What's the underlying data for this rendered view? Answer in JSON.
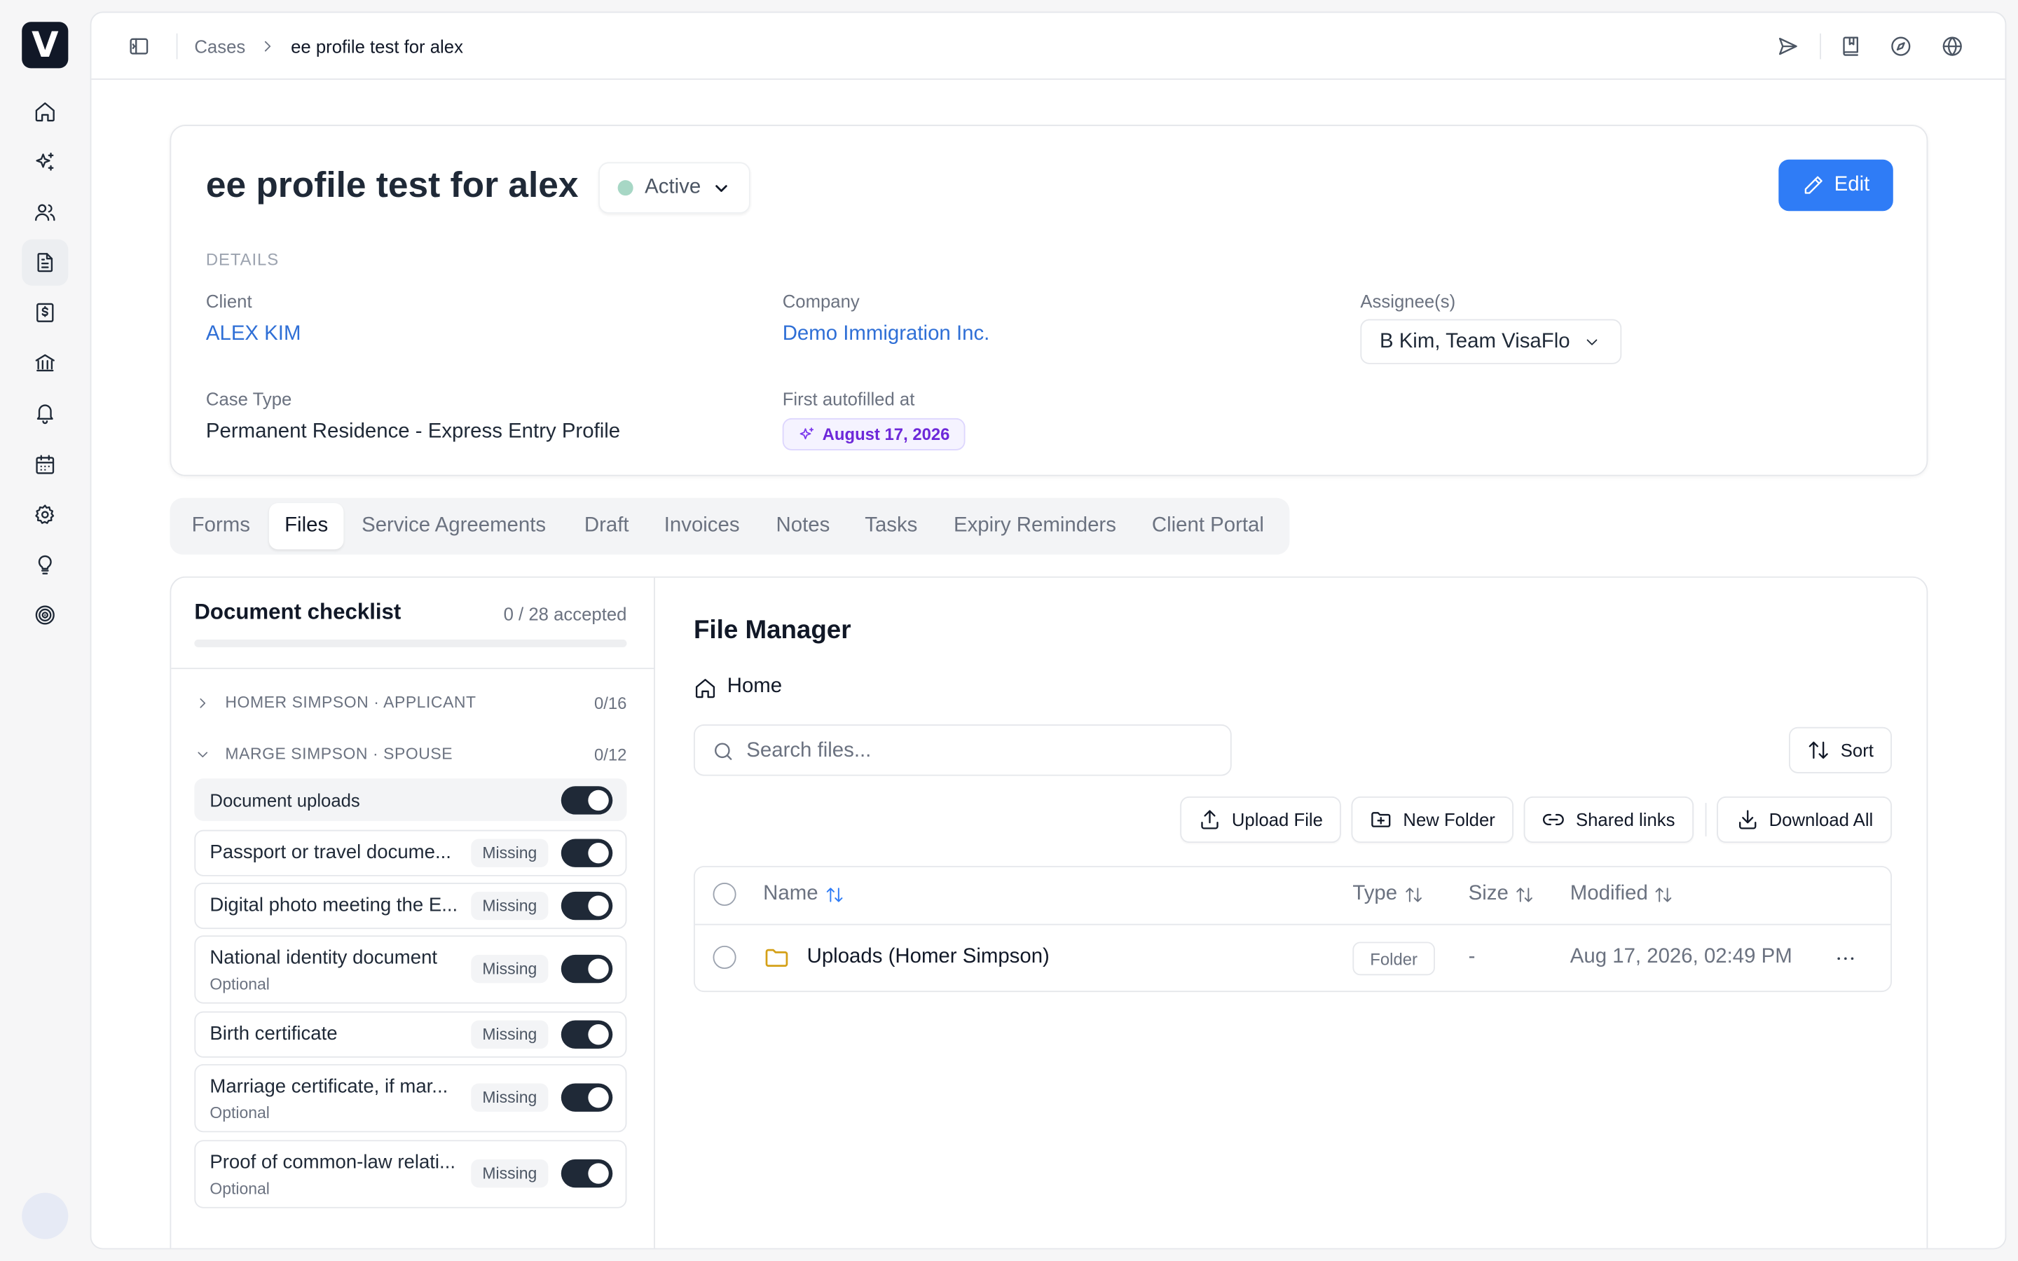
{
  "app": {
    "logo_letter": "V"
  },
  "sidebar": {
    "items": [
      {
        "icon": "home-icon"
      },
      {
        "icon": "sparkles-icon"
      },
      {
        "icon": "users-icon"
      },
      {
        "icon": "file-text-icon",
        "active": true
      },
      {
        "icon": "dollar-receipt-icon"
      },
      {
        "icon": "bank-icon"
      },
      {
        "icon": "bell-icon"
      },
      {
        "icon": "calendar-icon"
      },
      {
        "icon": "gear-icon"
      },
      {
        "icon": "lightbulb-icon"
      },
      {
        "icon": "fingerprint-icon"
      }
    ]
  },
  "topbar": {
    "breadcrumb": [
      "Cases",
      "ee profile test for alex"
    ],
    "icons": [
      "send-icon",
      "book-icon",
      "compass-icon",
      "globe-icon"
    ]
  },
  "case": {
    "title": "ee profile test for alex",
    "status": "Active",
    "edit_label": "Edit",
    "details_heading": "DETAILS",
    "client_label": "Client",
    "client": "ALEX KIM",
    "company_label": "Company",
    "company": "Demo Immigration Inc.",
    "assignee_label": "Assignee(s)",
    "assignees": "B Kim, Team VisaFlo",
    "case_type_label": "Case Type",
    "case_type": "Permanent Residence - Express Entry Profile",
    "autofill_label": "First autofilled at",
    "autofill_date": "August 17, 2026"
  },
  "tabs": [
    "Forms",
    "Files",
    "Service Agreements",
    "Draft",
    "Invoices",
    "Notes",
    "Tasks",
    "Expiry Reminders",
    "Client Portal"
  ],
  "active_tab": "Files",
  "checklist": {
    "title": "Document checklist",
    "count": "0 / 28 accepted",
    "progress": 0,
    "groups": [
      {
        "name": "HOMER SIMPSON · APPLICANT",
        "count": "0/16",
        "expanded": false
      },
      {
        "name": "MARGE SIMPSON · SPOUSE",
        "count": "0/12",
        "expanded": true
      }
    ],
    "uploads_label": "Document uploads",
    "items": [
      {
        "title": "Passport or travel docume...",
        "sub": "",
        "status": "Missing",
        "on": true
      },
      {
        "title": "Digital photo meeting the E...",
        "sub": "",
        "status": "Missing",
        "on": true
      },
      {
        "title": "National identity document",
        "sub": "Optional",
        "status": "Missing",
        "on": true
      },
      {
        "title": "Birth certificate",
        "sub": "",
        "status": "Missing",
        "on": true
      },
      {
        "title": "Marriage certificate, if mar...",
        "sub": "Optional",
        "status": "Missing",
        "on": true
      },
      {
        "title": "Proof of common-law relati...",
        "sub": "Optional",
        "status": "Missing",
        "on": true
      }
    ]
  },
  "file_manager": {
    "title": "File Manager",
    "path": "Home",
    "search_placeholder": "Search files...",
    "sort_label": "Sort",
    "actions": {
      "upload": "Upload File",
      "new_folder": "New Folder",
      "shared": "Shared links",
      "download_all": "Download All"
    },
    "columns": {
      "name": "Name",
      "type": "Type",
      "size": "Size",
      "modified": "Modified"
    },
    "rows": [
      {
        "name": "Uploads (Homer Simpson)",
        "type": "Folder",
        "size": "-",
        "modified": "Aug 17, 2026, 02:49 PM"
      }
    ]
  }
}
